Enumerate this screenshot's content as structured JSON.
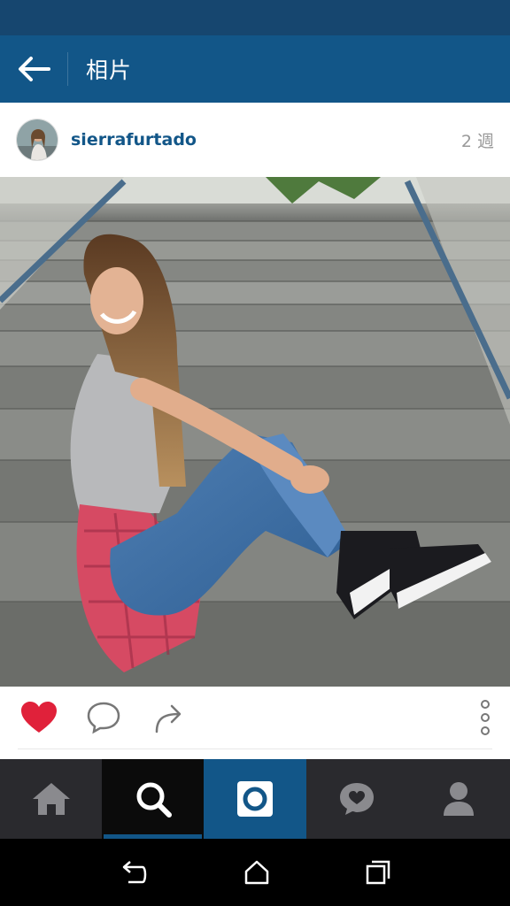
{
  "app_bar": {
    "title": "相片"
  },
  "post": {
    "username": "sierrafurtado",
    "time": "2 週"
  },
  "actions": {
    "liked": true,
    "like_color": "#e0213a"
  },
  "tabs": [
    "home",
    "explore",
    "camera",
    "activity",
    "profile"
  ],
  "nav": [
    "back",
    "home",
    "recents"
  ],
  "colors": {
    "brand": "#125688",
    "status": "#16466f",
    "tabbar": "#2a2a2e"
  },
  "icons": {
    "back": "back-arrow-icon",
    "like": "heart-icon",
    "comment": "comment-icon",
    "share": "share-icon",
    "more": "more-vertical-icon"
  }
}
